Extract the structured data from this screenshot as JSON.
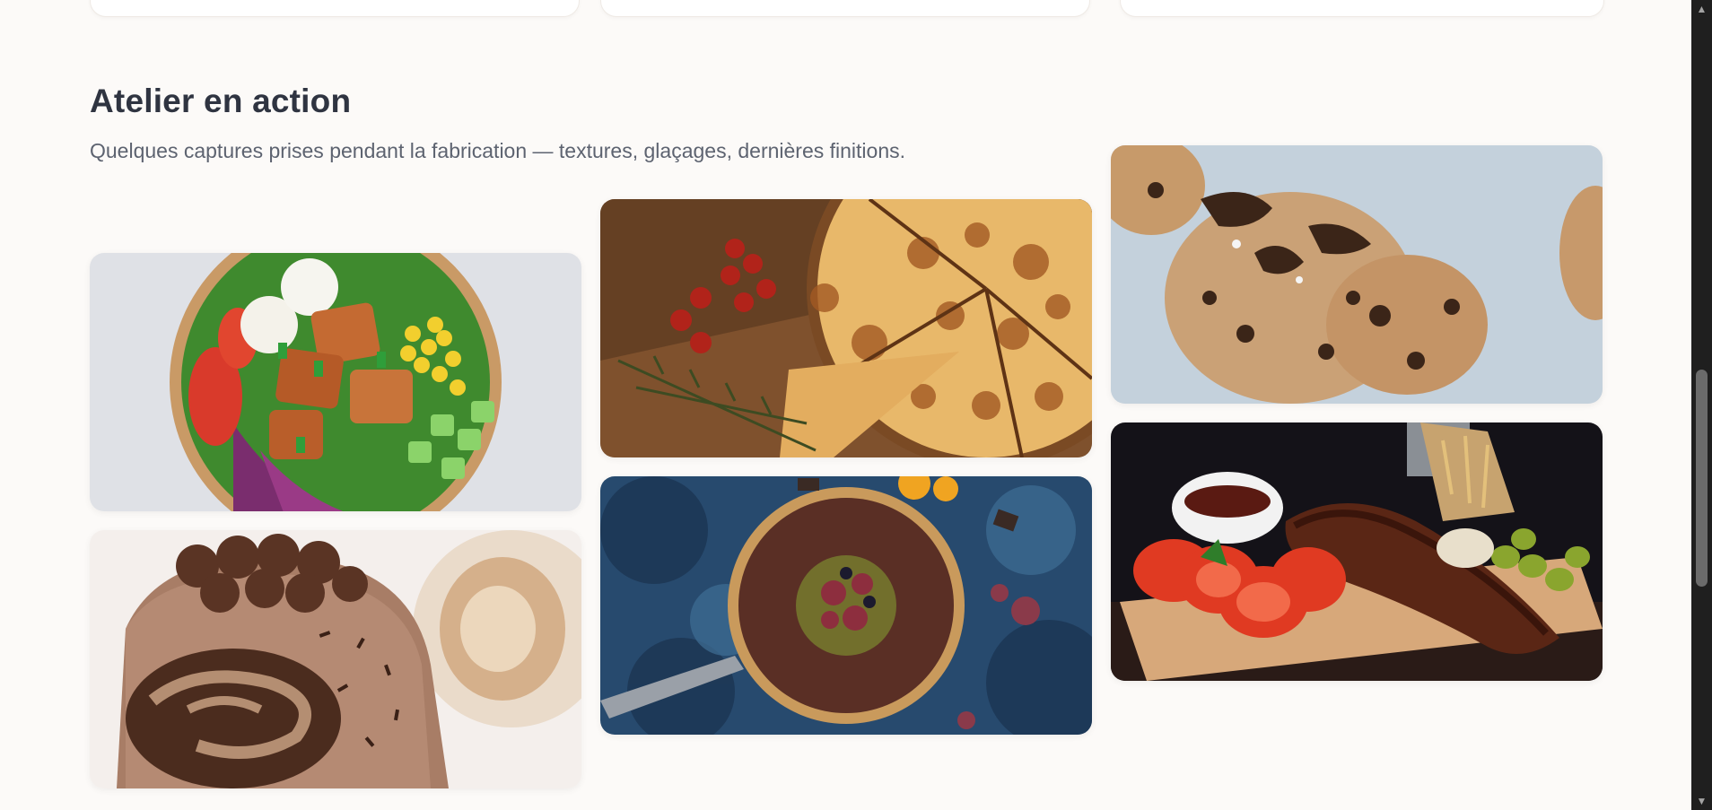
{
  "section": {
    "title": "Atelier en action",
    "subtitle": "Quelques captures prises pendant la fabrication — textures, glaçages, dernières finitions."
  },
  "gallery": {
    "photos": [
      {
        "subject": "salad-bowl-photo"
      },
      {
        "subject": "buche-cake-photo"
      },
      {
        "subject": "pizza-photo"
      },
      {
        "subject": "chocolate-tart-photo"
      },
      {
        "subject": "cookies-photo"
      },
      {
        "subject": "ribs-board-photo"
      }
    ]
  },
  "scrollbar": {
    "up_icon": "triangle-up-icon",
    "down_icon": "triangle-down-icon"
  },
  "colors": {
    "background": "#fcfaf8",
    "heading": "#2f3441",
    "subtitle": "#5d6370",
    "scrollbar_track": "#1f1f1f",
    "scrollbar_thumb": "#6b6b6b"
  }
}
